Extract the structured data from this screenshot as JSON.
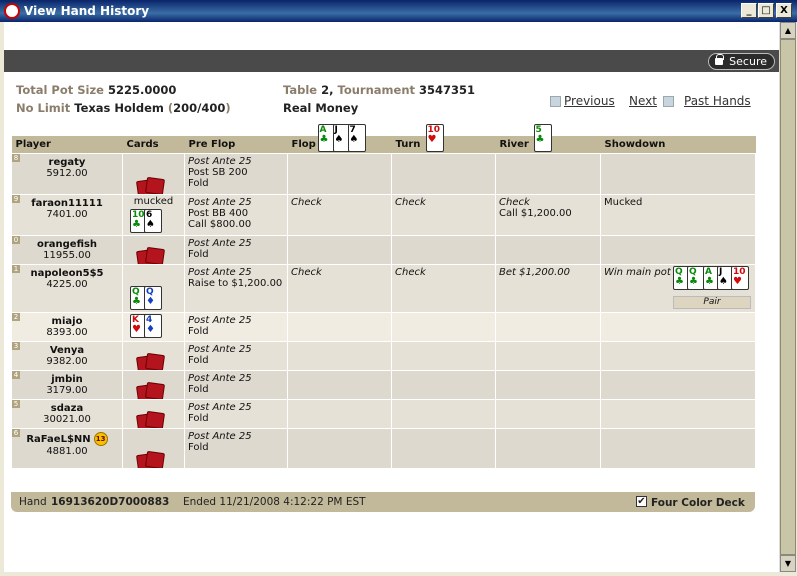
{
  "window": {
    "title": "View Hand History",
    "minimize": "_",
    "maximize": "□",
    "close": "X"
  },
  "secure_label": "Secure",
  "info": {
    "pot_label": "Total Pot Size",
    "pot_value": "5225.0000",
    "limit_label": "No Limit",
    "game": "Texas Holdem",
    "stakes_open": "(",
    "stakes": "200/400",
    "stakes_close": ")",
    "table_label": "Table",
    "table_value": "2,",
    "tournament_label": "Tournament",
    "tournament_value": "3547351",
    "money": "Real Money"
  },
  "nav": {
    "previous": "Previous",
    "next": "Next",
    "past": "Past Hands"
  },
  "columns": {
    "player": "Player",
    "cards": "Cards",
    "preflop": "Pre Flop",
    "flop": "Flop",
    "turn": "Turn",
    "river": "River",
    "showdown": "Showdown"
  },
  "board": {
    "flop": [
      {
        "rank": "A",
        "suit": "♣",
        "color": "c-grn"
      },
      {
        "rank": "J",
        "suit": "♠",
        "color": "c-blk"
      },
      {
        "rank": "7",
        "suit": "♠",
        "color": "c-blk"
      }
    ],
    "turn": {
      "rank": "10",
      "suit": "♥",
      "color": "c-red"
    },
    "river": {
      "rank": "5",
      "suit": "♣",
      "color": "c-grn"
    }
  },
  "players": [
    {
      "seat": "8",
      "name": "regaty",
      "chips": "5912.00",
      "preflop_italic": "Post Ante 25",
      "preflop": [
        "Post SB 200",
        "Fold"
      ],
      "flop": "",
      "turn": "",
      "river": "",
      "river_sub": "",
      "showdown": ""
    },
    {
      "seat": "9",
      "name": "faraon11111",
      "chips": "7401.00",
      "mucked": "mucked",
      "preflop_italic": "Post Ante 25",
      "preflop": [
        "Post BB 400",
        "Call $800.00"
      ],
      "flop": "Check",
      "turn": "Check",
      "river": "Check",
      "river_sub": "Call $1,200.00",
      "showdown": "Mucked"
    },
    {
      "seat": "0",
      "name": "orangefish",
      "chips": "11955.00",
      "preflop_italic": "Post Ante 25",
      "preflop": [
        "Fold"
      ],
      "flop": "",
      "turn": "",
      "river": "",
      "river_sub": "",
      "showdown": ""
    },
    {
      "seat": "1",
      "name": "napoleon5$5",
      "chips": "4225.00",
      "preflop_italic": "Post Ante 25",
      "preflop": [
        "Raise to $1,200.00"
      ],
      "flop": "Check",
      "turn": "Check",
      "river": "Bet $1,200.00",
      "river_sub": "",
      "showdown": "Win main pot",
      "hand": "Pair"
    },
    {
      "seat": "2",
      "name": "miajo",
      "chips": "8393.00",
      "preflop_italic": "Post Ante 25",
      "preflop": [
        "Fold"
      ],
      "flop": "",
      "turn": "",
      "river": "",
      "river_sub": "",
      "showdown": ""
    },
    {
      "seat": "3",
      "name": "Venya",
      "chips": "9382.00",
      "preflop_italic": "Post Ante 25",
      "preflop": [
        "Fold"
      ],
      "flop": "",
      "turn": "",
      "river": "",
      "river_sub": "",
      "showdown": ""
    },
    {
      "seat": "4",
      "name": "jmbin",
      "chips": "3179.00",
      "preflop_italic": "Post Ante 25",
      "preflop": [
        "Fold"
      ],
      "flop": "",
      "turn": "",
      "river": "",
      "river_sub": "",
      "showdown": ""
    },
    {
      "seat": "5",
      "name": "sdaza",
      "chips": "30021.00",
      "preflop_italic": "Post Ante 25",
      "preflop": [
        "Fold"
      ],
      "flop": "",
      "turn": "",
      "river": "",
      "river_sub": "",
      "showdown": ""
    },
    {
      "seat": "6",
      "name": "RaFaeL$NN",
      "chips": "4881.00",
      "badge": "13",
      "preflop_italic": "Post Ante 25",
      "preflop": [
        "Fold"
      ],
      "flop": "",
      "turn": "",
      "river": "",
      "river_sub": "",
      "showdown": ""
    }
  ],
  "hole_cards": {
    "faraon": [
      {
        "rank": "10",
        "suit": "♣",
        "color": "c-grn"
      },
      {
        "rank": "6",
        "suit": "♠",
        "color": "c-blk"
      }
    ],
    "napoleon": [
      {
        "rank": "Q",
        "suit": "♣",
        "color": "c-grn"
      },
      {
        "rank": "Q",
        "suit": "♦",
        "color": "c-blu"
      }
    ],
    "miajo": [
      {
        "rank": "K",
        "suit": "♥",
        "color": "c-red"
      },
      {
        "rank": "4",
        "suit": "♦",
        "color": "c-blu"
      }
    ],
    "showdown_hand": [
      {
        "rank": "Q",
        "suit": "♣",
        "color": "c-grn"
      },
      {
        "rank": "Q",
        "suit": "♣",
        "color": "c-grn"
      },
      {
        "rank": "A",
        "suit": "♣",
        "color": "c-grn"
      },
      {
        "rank": "J",
        "suit": "♠",
        "color": "c-blk"
      },
      {
        "rank": "10",
        "suit": "♥",
        "color": "c-red"
      }
    ]
  },
  "footer": {
    "hand_label": "Hand",
    "hand_id": "16913620D7000883",
    "ended": "Ended 11/21/2008 4:12:22 PM EST",
    "check": "✔",
    "four_color": "Four Color Deck"
  },
  "colors": {
    "title_bar": "#0a246a",
    "header_band": "#c2b99a",
    "row": "#ddd9cf",
    "card_back": "#b4141d"
  }
}
